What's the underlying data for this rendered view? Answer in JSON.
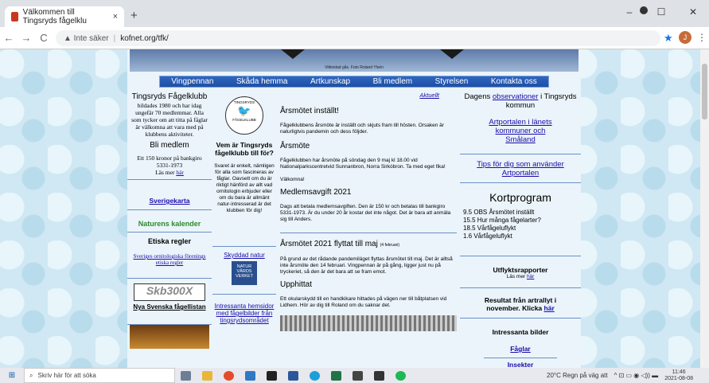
{
  "browser": {
    "tab_title": "Välkommen till Tingsryds fågelklu",
    "tab_close": "×",
    "new_tab": "+",
    "win_min": "–",
    "win_max": "☐",
    "win_close": "✕",
    "back": "←",
    "forward": "→",
    "reload": "C",
    "security": "▲ Inte säker",
    "separator": "|",
    "url": "kofnet.org/tfk/",
    "avatar_initial": "J",
    "star": "★",
    "menu": "⋮"
  },
  "site": {
    "banner_caption": "Vitkindad gås. Foto Roland Ylvén",
    "nav": [
      "Vingpennan",
      "Skåda hemma",
      "Artkunskap",
      "Bli medlem",
      "Styrelsen",
      "Kontakta oss"
    ],
    "colA": {
      "club_title": "Tingsryds Fågelklubb",
      "club_text": "bildades 1980 och har idag ungefär 70 medlemmar. Alla som tycker om att titta på fåglar är välkomna att vara med på klubbens aktiviteter.",
      "member_heading": "Bli medlem",
      "member_text": "Ett 150 kronor på bankgiro 5331-1973",
      "read_more": "Läs mer",
      "read_more_link": "här",
      "sverigekarta": "Sverigekarta",
      "naturens_kalender": "Naturens kalender",
      "etiska_heading": "Etiska regler",
      "etiska_link": "Sveriges ornitologiska förenings etiska regler",
      "skb_logo": "Skb300X",
      "nya_svenska": "Nya Svenska fågellistan"
    },
    "colB": {
      "logo_text_top": "TINGSRYDS",
      "logo_text_bottom": "FÅGELKLUBB",
      "who_heading": "Vem är Tingsryds fågelklubb till för?",
      "who_text": "Svaret är enkelt, nämligen för alla som fascineras av fåglar. Oavsett om du är riktigt hänförd av allt vad ornitologin erbjuder eller om du bara är allmänt natur-intresserad är det klubben för dig!",
      "skyddad_natur": "Skyddad natur",
      "naturvardsverket": "NATUR VÅRDS VERKET",
      "intressanta_hemsidor": "Intressanta hemsidor med fågelbilder från tingsrydsområdet"
    },
    "colC": {
      "aktuellt": "Aktuellt",
      "h1": "Årsmötet inställt!",
      "p1": "Fågelklubbens årsmöte är inställt och skjuts fram till hösten. Orsaken är naturligtvis pandemin och dess följder.",
      "h2": "Årsmöte",
      "p2": "Fågelklubben har årsmöte på söndag den 9 maj kl 18.00 vid Nationalparkscentretvid Sunnanbron, Norra Sirkóbron. Ta med eget fika!",
      "p2b": "Välkomna!",
      "h3": "Medlemsavgift 2021",
      "p3": "Dags att betala medlemsavgiften. Den är 150 kr och betalas till bankgiro 5331-1973. Är du under 20 år kostar det inte något. Det är bara att anmäla sig till Anders.",
      "h4": "Årsmötet 2021 flyttat till maj",
      "h4_small": "(4 februari)",
      "p4": "På grund av det rådande pandemiläget flyttas årsmötet till maj. Det är alltså inte årsmöte den 14 februari. Vingpennan är på gång, ligger just nu på tryckeriet, så den är det bara att se fram emot.",
      "h5": "Upphittat",
      "p5": "Ett okularskydd till en handkikare hittades på vägen ner till båtplatsen vid Lidhem. Hör av dig till Roland om du saknar det."
    },
    "colD": {
      "obs_text1": "Dagens",
      "obs_link": "observationer",
      "obs_text2": "i Tingsryds kommun",
      "artportalen_link": "Artportalen i länets kommuner och Småland",
      "tips_link": "Tips för dig som använder Artportalen",
      "kortprogram_heading": "Kortprogram",
      "kortprogram_items": [
        "9.5 OBS Årsmötet inställt",
        "15.5 Hur många fågelarter?",
        "18.5 Vårfågeluflykt",
        "1.6 Vårfågeluflykt"
      ],
      "utflykt_heading": "Utflyktsrapporter",
      "utflykt_text": "Läs mer",
      "utflykt_link": "här",
      "resultat_text": "Resultat från artrallyt i november. Klicka",
      "resultat_link": "här",
      "intressanta_bilder": "Intressanta bilder",
      "faglar_link": "Fåglar",
      "insekter_link": "Insekter"
    }
  },
  "taskbar": {
    "start": "⊞",
    "search_placeholder": "Skriv här för att söka",
    "weather": "20°C  Regn på väg att",
    "time": "11:46",
    "date": "2021-08-08"
  },
  "colors": {
    "nav_blue": "#2e66c0",
    "link": "#1a0dab",
    "accent_green": "#2d8a2d"
  }
}
